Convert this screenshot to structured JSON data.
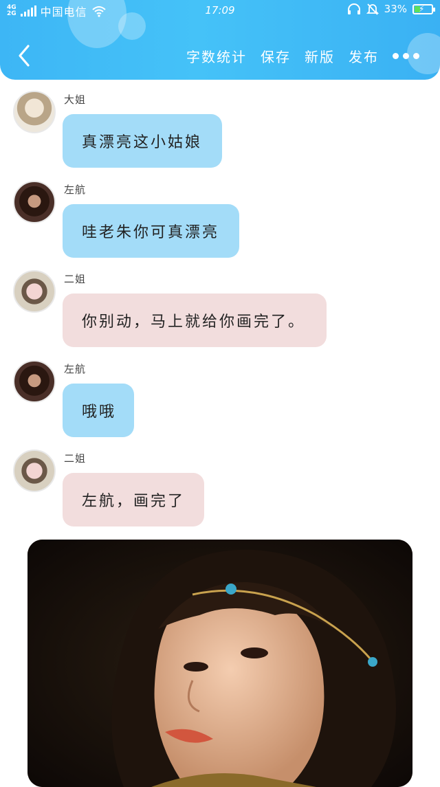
{
  "status_bar": {
    "network_top": "4G",
    "network_bottom": "2G",
    "carrier": "中国电信",
    "time": "17:09",
    "battery": "33%",
    "battery_level": 0.33
  },
  "header": {
    "toolbar": [
      "字数统计",
      "保存",
      "新版",
      "发布"
    ]
  },
  "messages": [
    {
      "sender": "大姐",
      "text": "真漂亮这小姑娘",
      "style": "blue"
    },
    {
      "sender": "左航",
      "text": "哇老朱你可真漂亮",
      "style": "blue"
    },
    {
      "sender": "二姐",
      "text": "你别动，马上就给你画完了。",
      "style": "pink"
    },
    {
      "sender": "左航",
      "text": "哦哦",
      "style": "blue"
    },
    {
      "sender": "二姐",
      "text": "左航，画完了",
      "style": "pink"
    }
  ],
  "colors": {
    "header": "#3db6f5",
    "bubble_blue": "#a3dcf8",
    "bubble_pink": "#f2dddd"
  }
}
